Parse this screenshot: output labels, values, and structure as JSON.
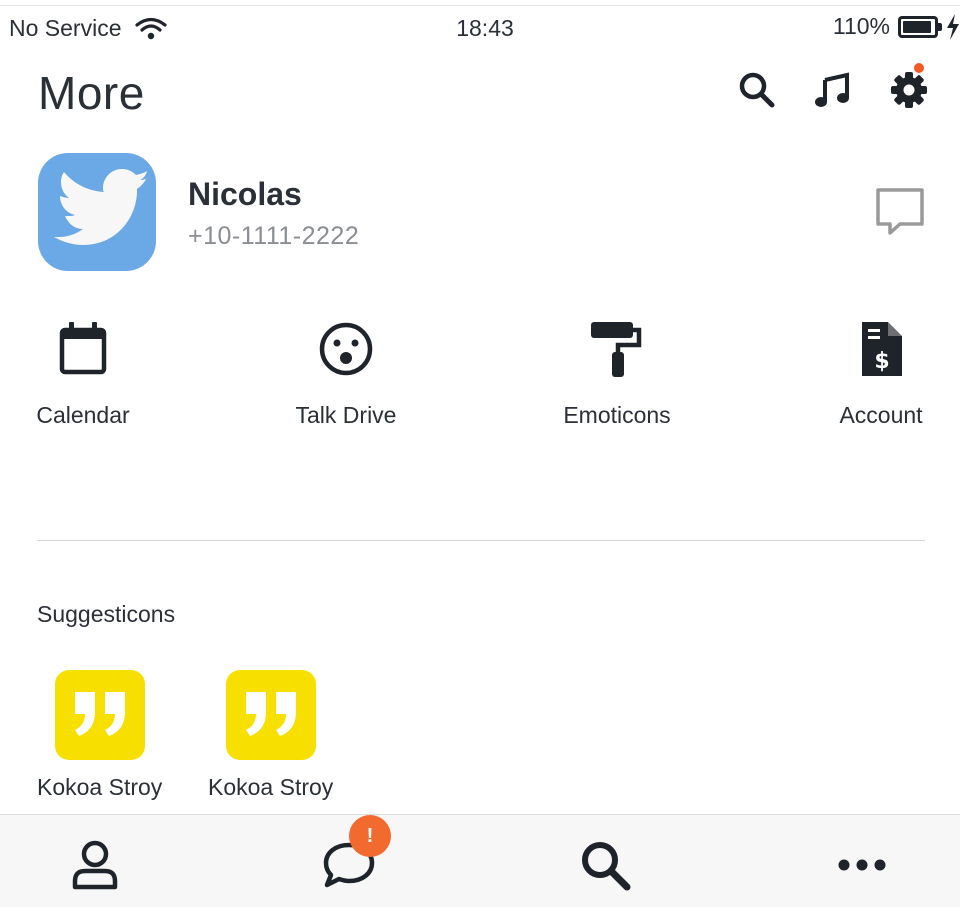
{
  "status_bar": {
    "carrier": "No Service",
    "time": "18:43",
    "battery": "110%",
    "wifi_icon": "wifi-icon",
    "battery_icon": "battery-icon",
    "charging_icon": "charging-bolt-icon"
  },
  "header": {
    "title": "More",
    "icons": [
      "search-icon",
      "music-note-icon",
      "gear-icon"
    ]
  },
  "profile": {
    "name": "Nicolas",
    "phone": "+10-1111-2222",
    "avatar_icon": "bird-icon",
    "chat_icon": "chat-bubble-icon"
  },
  "quick_actions": [
    {
      "label": "Calendar",
      "icon": "calendar-icon"
    },
    {
      "label": "Talk Drive",
      "icon": "surprised-face-icon"
    },
    {
      "label": "Emoticons",
      "icon": "paint-roller-icon"
    },
    {
      "label": "Account",
      "icon": "invoice-dollar-icon"
    }
  ],
  "suggestions": {
    "title": "Suggesticons",
    "items": [
      {
        "label": "Kokoa Stroy",
        "icon": "quote-icon"
      },
      {
        "label": "Kokoa Stroy",
        "icon": "quote-icon"
      }
    ]
  },
  "tabbar": {
    "tabs": [
      "person-icon",
      "chat-icon",
      "search-icon",
      "more-dots-icon"
    ],
    "chats_badge": "!"
  },
  "colors": {
    "accent_orange": "#f26a2e",
    "avatar_blue": "#6aa8e6",
    "suggestion_yellow": "#f7df00",
    "text_dark": "#2b2f36",
    "text_muted": "#8a8d92"
  }
}
